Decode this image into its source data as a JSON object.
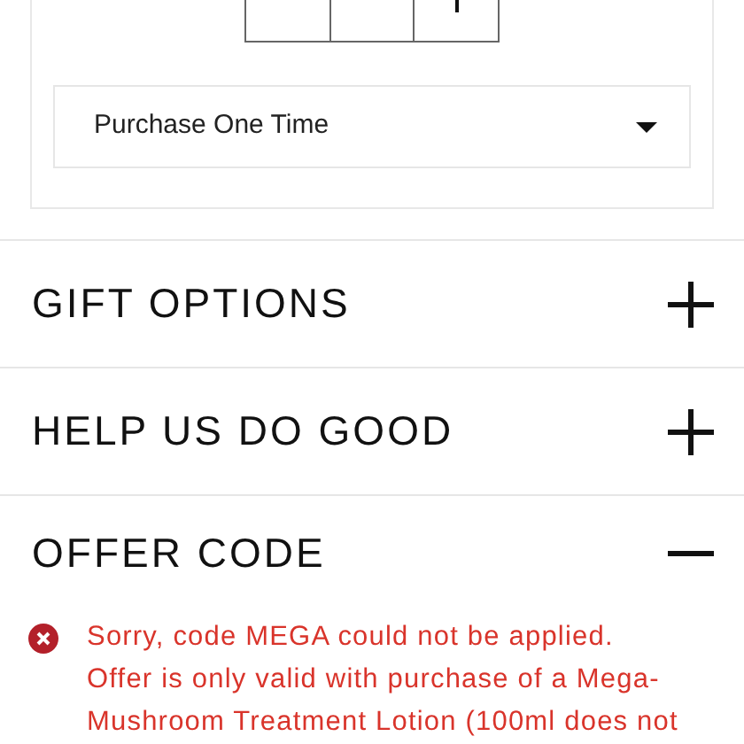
{
  "purchase_option": {
    "value": "Purchase One Time"
  },
  "sections": [
    {
      "title": "GIFT OPTIONS",
      "expanded": false
    },
    {
      "title": "HELP US DO GOOD",
      "expanded": false
    },
    {
      "title": "OFFER CODE",
      "expanded": true,
      "error_lines": [
        "Sorry, code MEGA could not be applied.",
        "Offer is only valid with purchase of a Mega-",
        "Mushroom Treatment Lotion (100ml does not"
      ]
    }
  ]
}
